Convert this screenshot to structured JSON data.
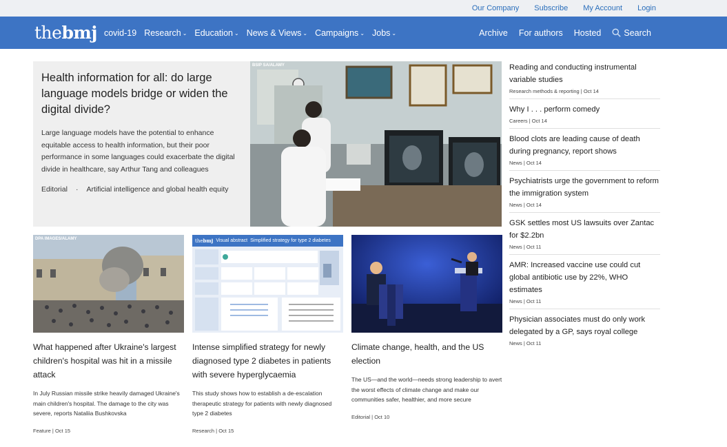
{
  "utility_nav": [
    "Our Company",
    "Subscribe",
    "My Account",
    "Login"
  ],
  "logo": {
    "light": "the",
    "bold": "bmj"
  },
  "nav_left": [
    {
      "label": "covid-19",
      "caret": false
    },
    {
      "label": "Research",
      "caret": true
    },
    {
      "label": "Education",
      "caret": true
    },
    {
      "label": "News & Views",
      "caret": true
    },
    {
      "label": "Campaigns",
      "caret": true
    },
    {
      "label": "Jobs",
      "caret": true
    }
  ],
  "nav_right": [
    "Archive",
    "For authors",
    "Hosted"
  ],
  "search_label": "Search",
  "hero": {
    "title": "Health information for all: do large language models bridge or widen the digital divide?",
    "description": "Large language models have the potential to enhance equitable access to health information, but their poor performance in some languages could exacerbate the digital divide in healthcare, say Arthur Tang and colleagues",
    "type": "Editorial",
    "collection": "Artificial intelligence and global health equity",
    "image_credit": "BSIP SA/ALAMY"
  },
  "sidebar": [
    {
      "title": "Reading and conducting instrumental variable studies",
      "meta": "Research methods & reporting | Oct 14"
    },
    {
      "title": "Why I . . . perform comedy",
      "meta": "Careers | Oct 14"
    },
    {
      "title": "Blood clots are leading cause of death during pregnancy, report shows",
      "meta": "News | Oct 14"
    },
    {
      "title": "Psychiatrists urge the government to reform the immigration system",
      "meta": "News | Oct 14"
    },
    {
      "title": "GSK settles most US lawsuits over Zantac for $2.2bn",
      "meta": "News | Oct 11"
    },
    {
      "title": "AMR: Increased vaccine use could cut global antibiotic use by 22%, WHO estimates",
      "meta": "News | Oct 11"
    },
    {
      "title": "Physician associates must do only work delegated by a GP, says royal college",
      "meta": "News | Oct 11"
    }
  ],
  "cards": [
    {
      "title": "What happened after Ukraine's largest children's hospital was hit in a missile attack",
      "description": "In July Russian missile strike heavily damaged Ukraine's main children's hospital. The damage to the city was severe, reports Nataliia Bushkovska",
      "meta": "Feature | Oct 15",
      "image_credit": "DPA IMAGES/ALAMY"
    },
    {
      "title": "Intense simplified strategy for newly diagnosed type 2 diabetes in patients with severe hyperglycaemia",
      "description": "This study shows how to establish a de-escalation therapeutic strategy for patients with newly diagnosed type 2 diabetes",
      "meta": "Research | Oct 15",
      "image_heading": "Visual abstract",
      "image_title": "Simplified strategy for type 2 diabetes"
    },
    {
      "title": "Climate change, health, and the US election",
      "description": "The US—and the world—needs strong leadership to avert the worst effects of climate change and make our communities safer, healthier, and more secure",
      "meta": "Editorial | Oct 10"
    }
  ],
  "colors": {
    "brand_blue": "#3d74c4",
    "link_blue": "#2a6ebb"
  }
}
